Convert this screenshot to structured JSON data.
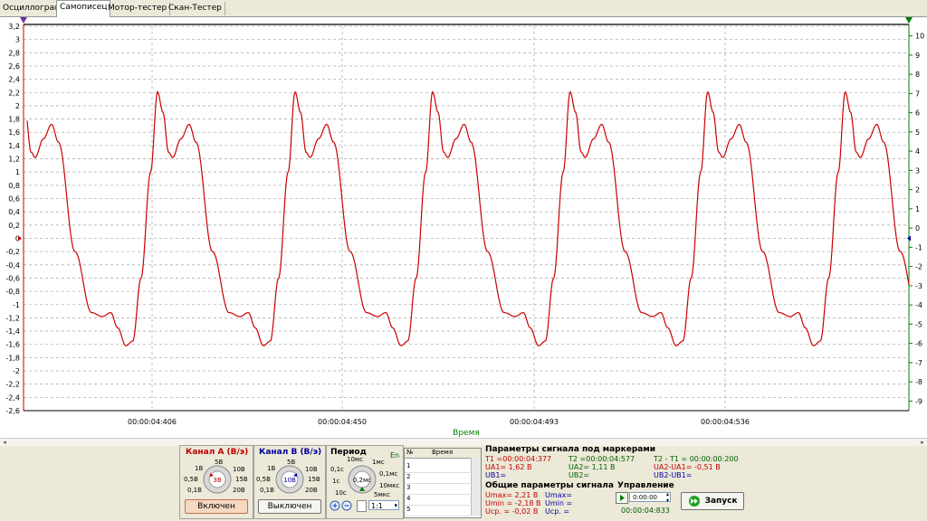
{
  "tabs": [
    {
      "label": "Осциллограф",
      "active": false
    },
    {
      "label": "Самописец",
      "active": true
    },
    {
      "label": "Мотор-тестер",
      "active": false
    },
    {
      "label": "Скан-Тестер",
      "active": false
    }
  ],
  "chart_data": {
    "type": "line",
    "title": "",
    "xlabel": "Время",
    "ylabel": "",
    "x_tick_labels": [
      "00:00:04:406",
      "00:00:04:450",
      "00:00:04:493",
      "00:00:04:536"
    ],
    "ylim": [
      -2.6,
      3.4
    ],
    "y_ticks": [
      "3,2",
      "3",
      "2,8",
      "2,6",
      "2,4",
      "2,2",
      "2",
      "1,8",
      "1,6",
      "1,4",
      "1,2",
      "1",
      "0,8",
      "0,6",
      "0,4",
      "0,2",
      "0",
      "-0,2",
      "-0,4",
      "-0,6",
      "-0,8",
      "-1",
      "-1,2",
      "-1,4",
      "-1,6",
      "-1,8",
      "-2",
      "-2,2",
      "-2,4",
      "-2,6"
    ],
    "y2lim": [
      -10,
      11
    ],
    "y2_ticks": [
      "10",
      "9",
      "8",
      "7",
      "6",
      "5",
      "4",
      "3",
      "2",
      "1",
      "0",
      "-1",
      "-2",
      "-3",
      "-4",
      "-5",
      "-6",
      "-7",
      "-8",
      "-9"
    ],
    "grid": true,
    "series": [
      {
        "color": "#cc0000",
        "period": 0.0312,
        "x_start": 0.0,
        "x_end": 0.1944,
        "shape_points": [
          [
            0.0,
            1.3
          ],
          [
            0.03,
            1.22
          ],
          [
            0.09,
            1.5
          ],
          [
            0.15,
            1.72
          ],
          [
            0.2,
            1.45
          ],
          [
            0.32,
            -0.2
          ],
          [
            0.44,
            -1.12
          ],
          [
            0.52,
            -1.18
          ],
          [
            0.58,
            -1.12
          ],
          [
            0.63,
            -1.35
          ],
          [
            0.69,
            -1.62
          ],
          [
            0.74,
            -1.55
          ],
          [
            0.8,
            -0.6
          ],
          [
            0.87,
            1.0
          ],
          [
            0.92,
            2.21
          ],
          [
            0.96,
            1.9
          ],
          [
            1.0,
            1.3
          ]
        ]
      }
    ]
  },
  "channel_a": {
    "title": "Канал А (В/э)",
    "value": "3В",
    "labels": [
      "5В",
      "10В",
      "15В",
      "20В",
      "0,1В",
      "0,5В",
      "1В"
    ],
    "button": "Включен",
    "color": "#c00000"
  },
  "channel_b": {
    "title": "Канал В (В/э)",
    "value": "10В",
    "labels": [
      "5В",
      "10В",
      "15В",
      "20В",
      "0,1В",
      "0,5В",
      "1В"
    ],
    "button": "Выключен",
    "color": "#0000a0"
  },
  "period": {
    "title": "Период",
    "en": "En",
    "value": "0,2мс",
    "labels": [
      "10мс",
      "1мс",
      "0,1мс",
      "10мкс",
      "5мкс",
      "0,1с",
      "1с",
      "10с"
    ],
    "ratio": "1:1"
  },
  "time_table": {
    "col_num": "№",
    "col_time": "Время",
    "rows": [
      "1",
      "2",
      "3",
      "4",
      "5"
    ]
  },
  "markers": {
    "title": "Параметры сигнала под маркерами",
    "t1": "T1 =00:00:04:377",
    "t2": "T2 =00:00:04:577",
    "dt": "T2 - T1 = 00:00:00:200",
    "ua1": "UA1= 1,62 В",
    "ua2": "UA2= 1,11 В",
    "dua": "UA2-UA1= -0,51 В",
    "ub1": "UB1=",
    "ub2": "UB2=",
    "dub": "UB2-UB1="
  },
  "general": {
    "title": "Общие параметры сигнала",
    "umax_a": "Umax= 2,21 В",
    "umin_a": "Umin = -2,18 В",
    "ucp_a": "Uср. = -0,02 В",
    "umax_b": "Umax=",
    "umin_b": "Umin =",
    "ucp_b": "Uср. ="
  },
  "control": {
    "title": "Управление",
    "time_value": "0:00:00",
    "elapsed": "00:00:04:833",
    "start_label": "Запуск"
  }
}
